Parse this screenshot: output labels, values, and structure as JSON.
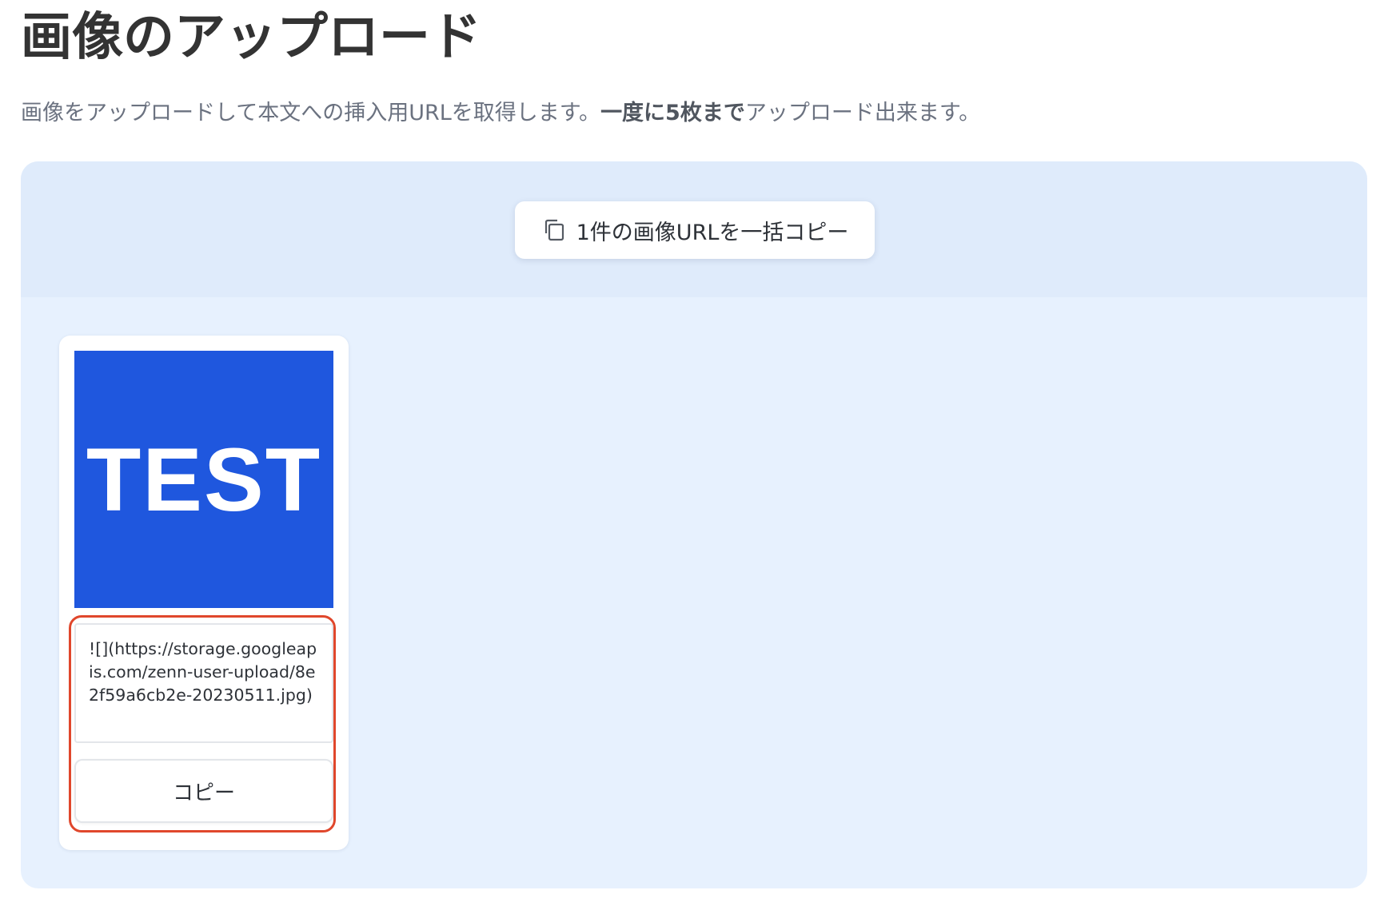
{
  "page": {
    "title": "画像のアップロード",
    "description_prefix": "画像をアップロードして本文への挿入用URLを取得します。",
    "description_bold": "一度に5枚まで",
    "description_suffix": "アップロード出来ます。"
  },
  "toolbar": {
    "bulk_copy_label": "1件の画像URLを一括コピー",
    "bulk_copy_icon": "copy-icon"
  },
  "images": [
    {
      "thumbnail_text": "TEST",
      "thumbnail_color": "#1f57de",
      "markdown_url": "![](https://storage.googleapis.com/zenn-user-upload/8e2f59a6cb2e-20230511.jpg)",
      "copy_label": "コピー"
    }
  ],
  "colors": {
    "panel_background": "#e7f1fe",
    "highlight_border": "#e0472c"
  }
}
